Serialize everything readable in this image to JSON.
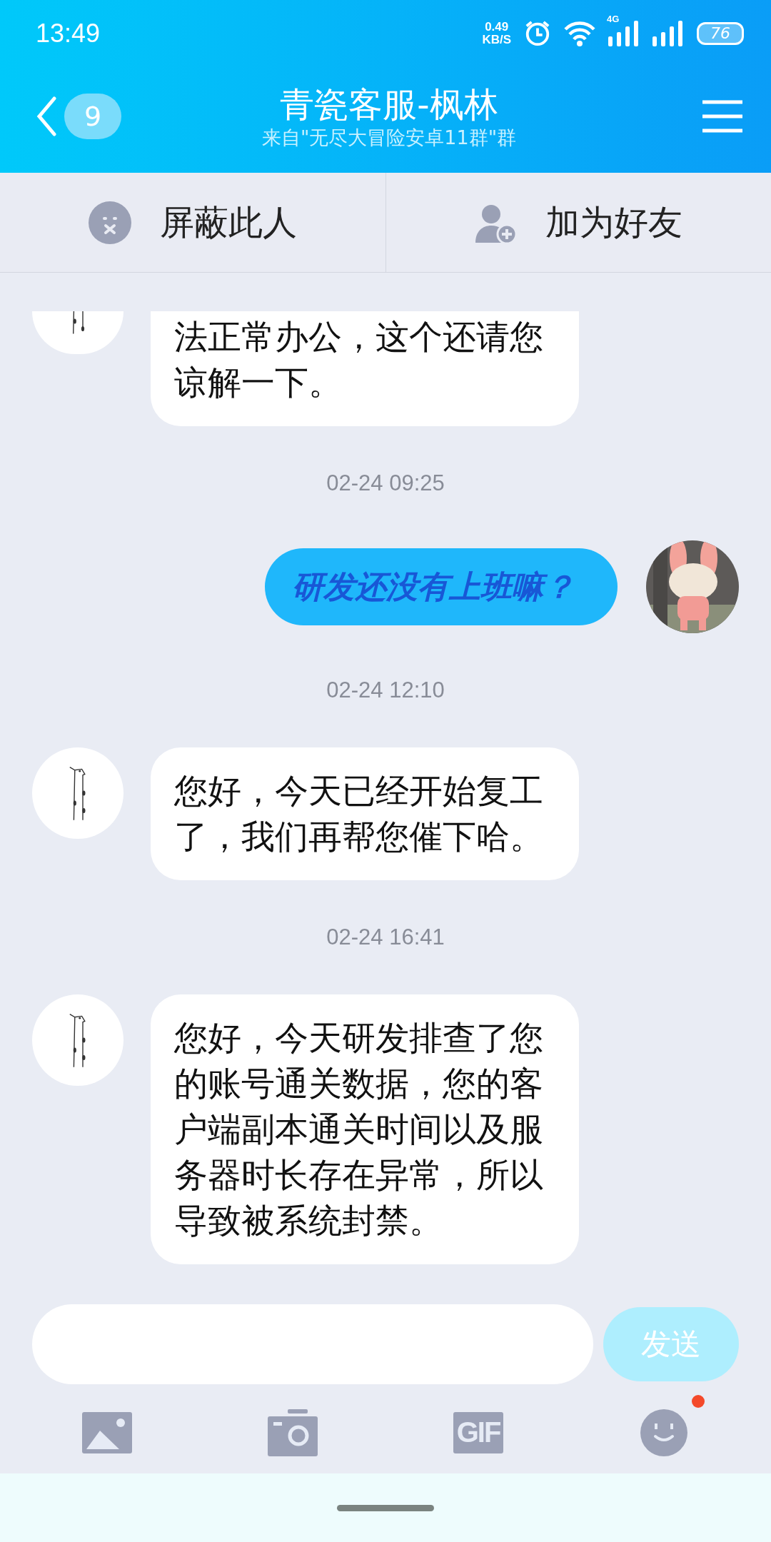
{
  "status_bar": {
    "time": "13:49",
    "net_speed": "0.49",
    "net_unit": "KB/S",
    "network": "4G",
    "battery": "76"
  },
  "header": {
    "badge": "9",
    "title": "青瓷客服-枫林",
    "subtitle": "来自\"无尽大冒险安卓11群\"群"
  },
  "actions": [
    "屏蔽此人",
    "加为好友"
  ],
  "messages": [
    {
      "kind": "incoming_partial",
      "text": "法正常办公，这个还请您谅解一下。"
    },
    {
      "kind": "time",
      "text": "02-24 09:25"
    },
    {
      "kind": "outgoing",
      "text": "研发还没有上班嘛？"
    },
    {
      "kind": "time",
      "text": "02-24 12:10"
    },
    {
      "kind": "incoming",
      "text": "您好，今天已经开始复工了，我们再帮您催下哈。"
    },
    {
      "kind": "time",
      "text": "02-24 16:41"
    },
    {
      "kind": "incoming",
      "text": "您好，今天研发排查了您的账号通关数据，您的客户端副本通关时间以及服务器时长存在异常，所以导致被系统封禁。"
    }
  ],
  "composer": {
    "send": "发送"
  },
  "toolbar": {
    "gif_label": "GIF",
    "emoji_dot": true
  }
}
